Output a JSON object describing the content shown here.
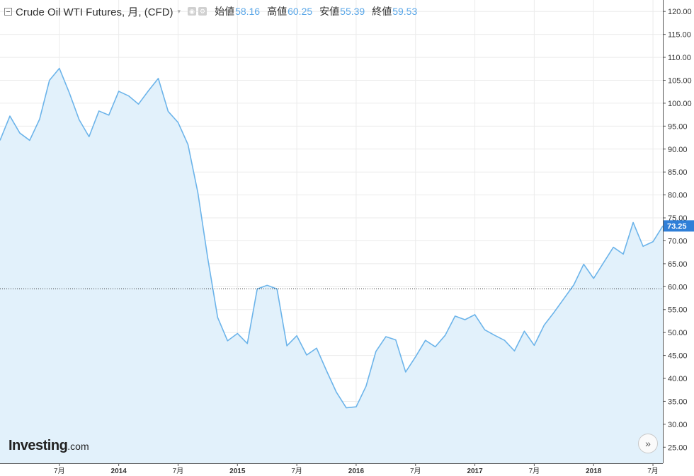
{
  "header": {
    "symbol": "Crude Oil WTI Futures, 月, (CFD)",
    "caret": "▾",
    "ohlc": [
      {
        "label": "始値",
        "value": "58.16"
      },
      {
        "label": "高値",
        "value": "60.25"
      },
      {
        "label": "安値",
        "value": "55.39"
      },
      {
        "label": "終値",
        "value": "59.53"
      }
    ]
  },
  "logo": {
    "main": "Investing",
    "suffix": ".com"
  },
  "nav": {
    "scroll_forward": "»"
  },
  "colors": {
    "line": "#6cb4ea",
    "area": "#e2f1fb",
    "price_tag": "#2f7fd8",
    "grid": "#ebebeb"
  },
  "chart_data": {
    "type": "area",
    "ylim": [
      21.5,
      122.5
    ],
    "y_ticks": [
      25,
      30,
      35,
      40,
      45,
      50,
      55,
      60,
      65,
      70,
      75,
      80,
      85,
      90,
      95,
      100,
      105,
      110,
      115,
      120
    ],
    "x_ticks": [
      "7月",
      "2014",
      "7月",
      "2015",
      "7月",
      "2016",
      "7月",
      "2017",
      "7月",
      "2018",
      "7月"
    ],
    "last_price": "73.25",
    "reference_line": 59.53,
    "series": [
      {
        "values": [
          91.9,
          97.2,
          93.5,
          91.9,
          96.5,
          105.0,
          107.6,
          102.3,
          96.4,
          92.7,
          98.3,
          97.4,
          102.6,
          101.6,
          99.8,
          102.7,
          105.4,
          98.2,
          95.8,
          91.0,
          80.5,
          66.2,
          53.3,
          48.2,
          49.8,
          47.6,
          59.5,
          60.3,
          59.5,
          47.1,
          49.3,
          45.1,
          46.6,
          41.7,
          37.0,
          33.6,
          33.8,
          38.3,
          45.9,
          49.1,
          48.4,
          41.4,
          44.7,
          48.3,
          46.9,
          49.4,
          53.6,
          52.8,
          53.9,
          50.6,
          49.4,
          48.3,
          46.0,
          50.3,
          47.2,
          51.6,
          54.4,
          57.4,
          60.4,
          64.9,
          61.8,
          65.2,
          68.6,
          67.1,
          74.0,
          68.8,
          69.8,
          73.25
        ]
      }
    ]
  }
}
